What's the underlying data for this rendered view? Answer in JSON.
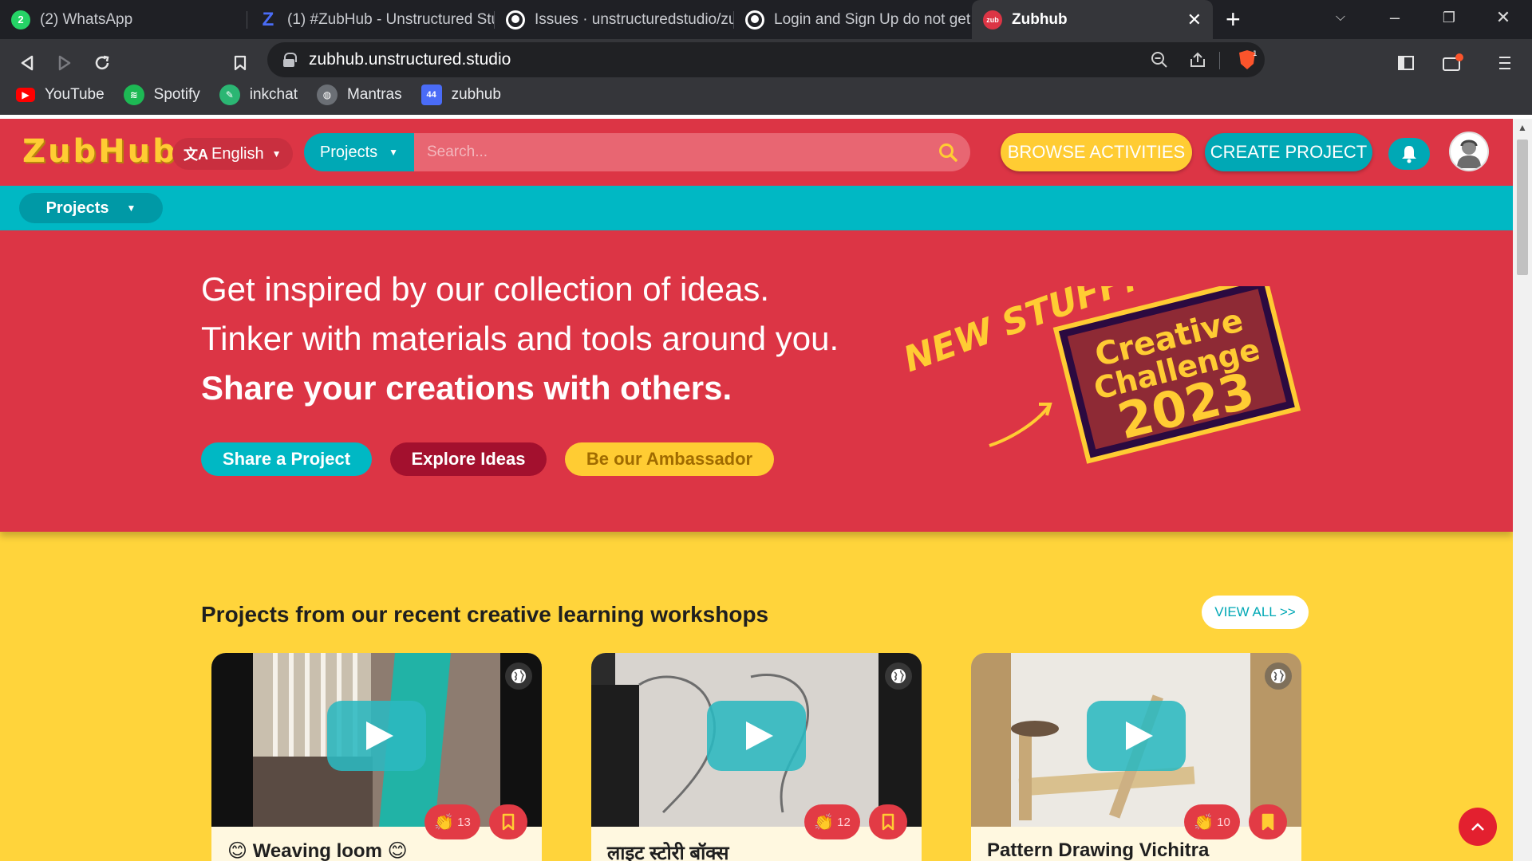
{
  "browser": {
    "tabs": [
      {
        "label": "(2) WhatsApp",
        "favicon": "whatsapp-icon",
        "color": "#25d366",
        "badge": "2"
      },
      {
        "label": "(1) #ZubHub - Unstructured Stu",
        "favicon": "zubhub-z-icon",
        "color": "#4a6cf7"
      },
      {
        "label": "Issues · unstructuredstudio/zub",
        "favicon": "github-icon",
        "color": "#ffffff"
      },
      {
        "label": "Login and Sign Up do not get s",
        "favicon": "github-icon",
        "color": "#ffffff"
      },
      {
        "label": "Zubhub",
        "favicon": "zubhub-icon",
        "color": "#dc3545",
        "active": true
      }
    ],
    "address": "zubhub.unstructured.studio",
    "brave_badge": "1",
    "bookmarks": [
      {
        "label": "YouTube",
        "icon": "youtube-icon",
        "color": "#ff0000"
      },
      {
        "label": "Spotify",
        "icon": "spotify-icon",
        "color": "#1db954"
      },
      {
        "label": "inkchat",
        "icon": "inkchat-icon",
        "color": "#2bb673"
      },
      {
        "label": "Mantras",
        "icon": "globe-icon",
        "color": "#9aa0a6"
      },
      {
        "label": "zubhub",
        "icon": "zubhub-bookmark-icon",
        "color": "#4a6cf7",
        "badge": "44"
      }
    ]
  },
  "header": {
    "logo": "ZubHub",
    "language": "English",
    "search_category": "Projects",
    "search_placeholder": "Search...",
    "browse_label": "BROWSE ACTIVITIES",
    "create_label": "CREATE PROJECT"
  },
  "subnav": {
    "projects_label": "Projects"
  },
  "hero": {
    "line1": "Get inspired by our collection of ideas.",
    "line2": "Tinker with materials and tools around you.",
    "line3": "Share your creations with others.",
    "buttons": {
      "share": "Share a Project",
      "explore": "Explore Ideas",
      "ambassador": "Be our Ambassador"
    },
    "new_stuff": "NEW STUFF!",
    "challenge_line1": "Creative",
    "challenge_line2": "Challenge",
    "challenge_year": "2023"
  },
  "section": {
    "title": "Projects from our recent creative learning workshops",
    "view_all": "VIEW ALL >>"
  },
  "cards": [
    {
      "title": "😊 Weaving loom 😊",
      "claps": "13"
    },
    {
      "title": "लाइट स्टोरी बॉक्स",
      "claps": "12"
    },
    {
      "title": "Pattern Drawing Vichitra",
      "claps": "10"
    }
  ],
  "colors": {
    "brand_red": "#dc3545",
    "brand_teal": "#00b8c4",
    "brand_yellow": "#ffd43b"
  }
}
